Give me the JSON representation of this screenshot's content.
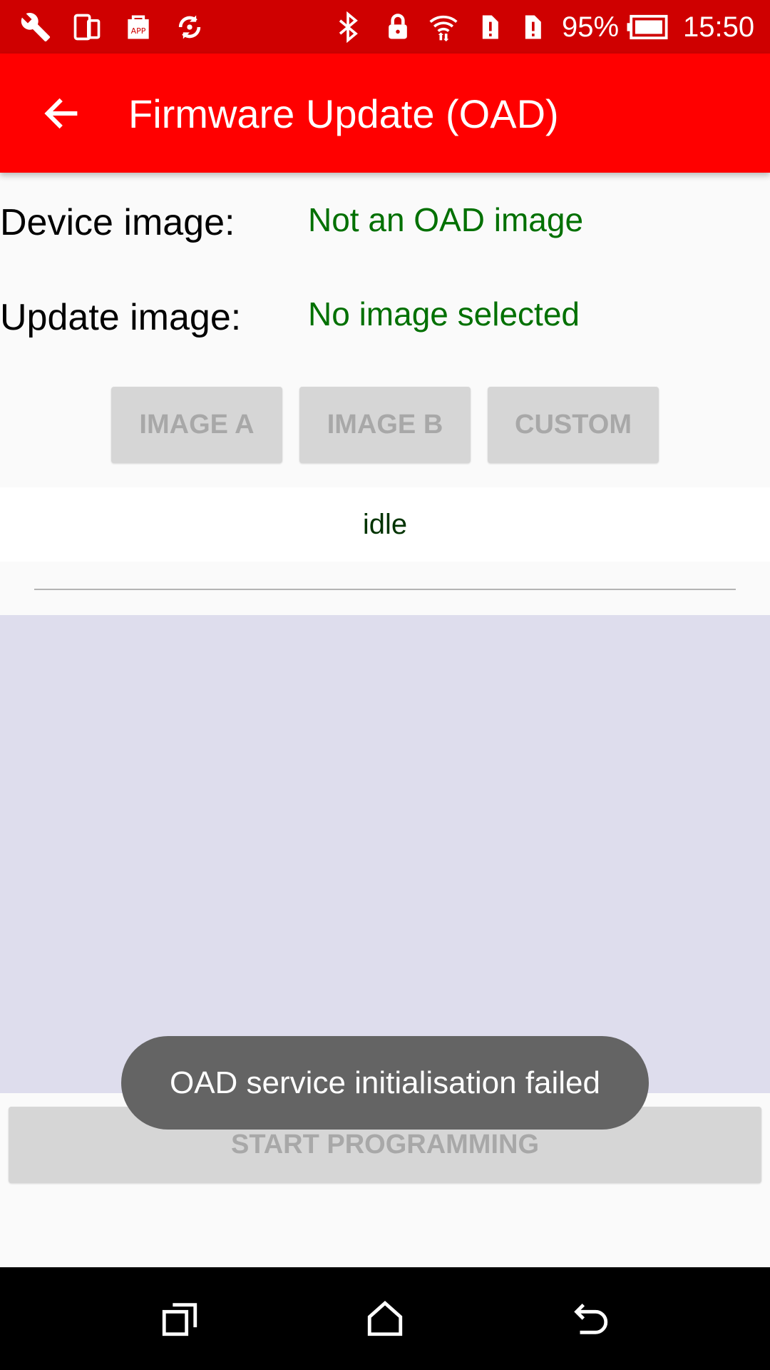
{
  "status_bar": {
    "battery_percent": "95%",
    "time": "15:50",
    "icons": [
      "wrench-icon",
      "devices-icon",
      "app-store-icon",
      "sync-icon",
      "bluetooth-icon",
      "lock-icon",
      "wifi-icon",
      "sim-alert-icon",
      "sim-alert-icon",
      "battery-icon"
    ]
  },
  "app_bar": {
    "back_icon": "arrow-left-icon",
    "title": "Firmware Update (OAD)",
    "background": "#ff0000"
  },
  "device_image": {
    "label": "Device image:",
    "value": "Not an OAD image"
  },
  "update_image": {
    "label": "Update image:",
    "value": "No image selected"
  },
  "image_buttons": [
    "IMAGE A",
    "IMAGE B",
    "CUSTOM"
  ],
  "status_text": "idle",
  "progress": 0,
  "start_button": "START PROGRAMMING",
  "toast": "OAD service initialisation failed",
  "nav_bar": {
    "icons": [
      "recent-apps-icon",
      "home-icon",
      "back-icon"
    ]
  },
  "colors": {
    "status_bar": "#cf0000",
    "value_text": "#007000",
    "log_area": "#dedded"
  }
}
